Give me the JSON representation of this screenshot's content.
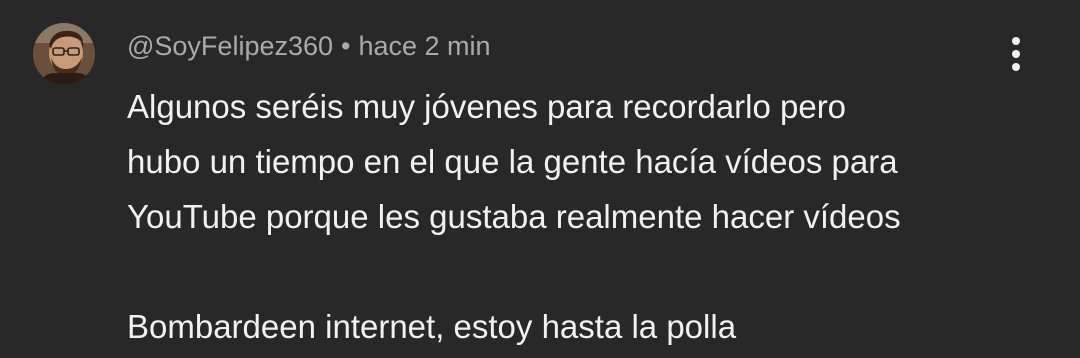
{
  "comment": {
    "author": "@SoyFelipez360",
    "separator": "•",
    "timestamp": "hace 2 min",
    "lines": [
      "Algunos seréis muy jóvenes para recordarlo pero",
      "hubo un tiempo en el que la gente hacía vídeos para",
      "YouTube porque les gustaba realmente hacer vídeos"
    ],
    "last_line": "Bombardeen internet, estoy hasta la polla",
    "avatar_icon": "user-avatar-icon",
    "menu_icon": "more-vertical-icon"
  },
  "colors": {
    "background": "#282828",
    "text": "#f1f1f1",
    "meta": "#aaaaaa"
  }
}
